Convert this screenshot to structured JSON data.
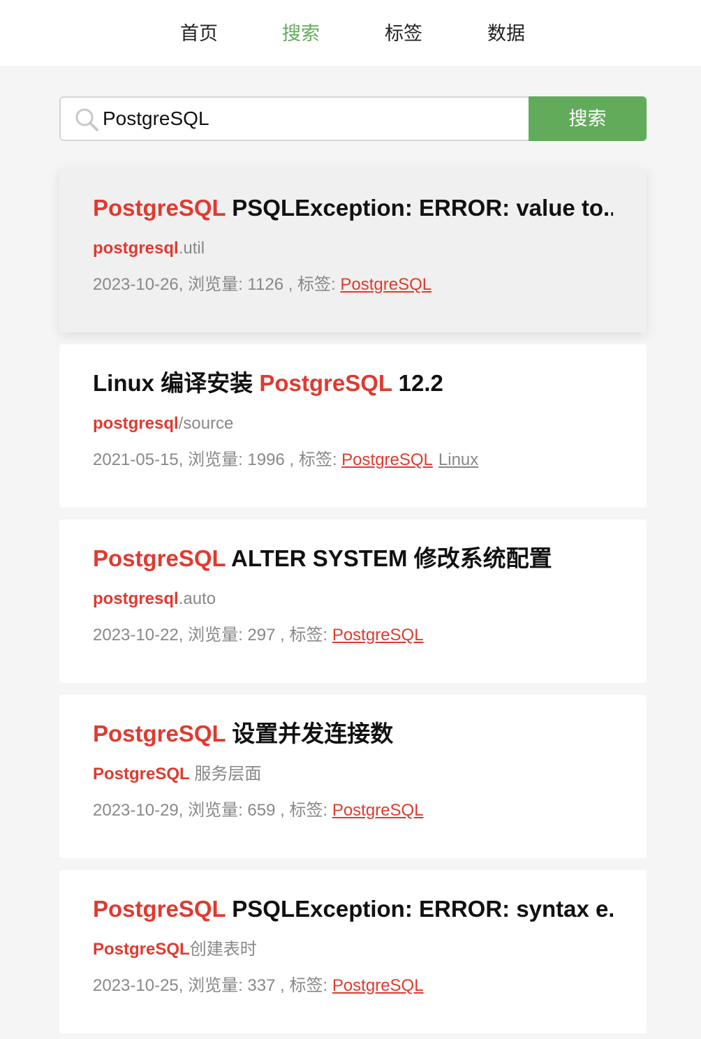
{
  "nav": {
    "items": [
      {
        "label": "首页"
      },
      {
        "label": "搜索",
        "active": true
      },
      {
        "label": "标签"
      },
      {
        "label": "数据"
      }
    ]
  },
  "search": {
    "value": "PostgreSQL",
    "button_label": "搜索",
    "icon": "search-icon"
  },
  "colors": {
    "accent": "#62ab5a",
    "highlight": "#e03a2f"
  },
  "results": [
    {
      "title_hl": "PostgreSQL",
      "title_rest": " PSQLException: ERROR: value to...",
      "sub_hl": "postgresql",
      "sub_rest": ".util",
      "meta": "2023-10-26, 浏览量: 1126 , 标签: ",
      "tags": [
        {
          "label": "PostgreSQL",
          "hl": true
        }
      ]
    },
    {
      "title_pre": "Linux 编译安装 ",
      "title_hl": "PostgreSQL",
      "title_rest": " 12.2",
      "sub_hl": "postgresql",
      "sub_rest": "/source",
      "meta": "2021-05-15, 浏览量: 1996 , 标签: ",
      "tags": [
        {
          "label": "PostgreSQL",
          "hl": true
        },
        {
          "label": "Linux",
          "hl": false
        }
      ]
    },
    {
      "title_hl": "PostgreSQL",
      "title_rest": " ALTER SYSTEM 修改系统配置",
      "sub_hl": "postgresql",
      "sub_rest": ".auto",
      "meta": "2023-10-22, 浏览量: 297 , 标签: ",
      "tags": [
        {
          "label": "PostgreSQL",
          "hl": true
        }
      ]
    },
    {
      "title_hl": "PostgreSQL",
      "title_rest": " 设置并发连接数",
      "sub_hl": "PostgreSQL",
      "sub_rest": " 服务层面",
      "meta": "2023-10-29, 浏览量: 659 , 标签: ",
      "tags": [
        {
          "label": "PostgreSQL",
          "hl": true
        }
      ]
    },
    {
      "title_hl": "PostgreSQL",
      "title_rest": " PSQLException: ERROR: syntax e...",
      "sub_hl": "PostgreSQL",
      "sub_rest": "创建表时",
      "meta": "2023-10-25, 浏览量: 337 , 标签: ",
      "tags": [
        {
          "label": "PostgreSQL",
          "hl": true
        }
      ]
    }
  ]
}
